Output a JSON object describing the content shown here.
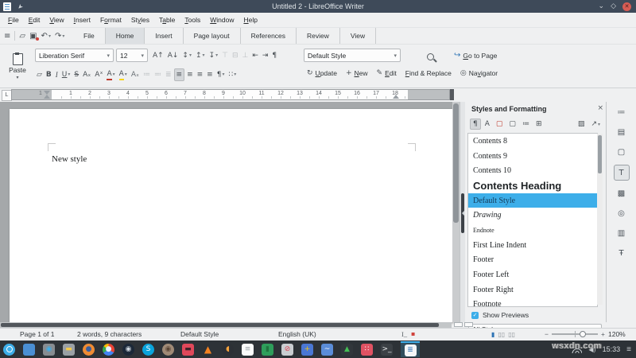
{
  "window": {
    "title": "Untitled 2 - LibreOffice Writer",
    "pin_icon": "➤",
    "minimize_icon": "⌄",
    "maximize_icon": "◇",
    "close_icon": "✕"
  },
  "colors": {
    "accent": "#3daee9",
    "titlebar": "#3e4a59",
    "taskbar": "#2d3237",
    "close_button": "#d75c54",
    "selection_text": "#153a57"
  },
  "menubar": {
    "items": [
      {
        "key": "F",
        "post": "ile"
      },
      {
        "key": "E",
        "post": "dit"
      },
      {
        "key": "V",
        "post": "iew"
      },
      {
        "key": "I",
        "post": "nsert"
      },
      {
        "pre": "F",
        "key": "o",
        "post": "rmat"
      },
      {
        "pre": "St",
        "key": "y",
        "post": "les"
      },
      {
        "pre": "T",
        "key": "a",
        "post": "ble"
      },
      {
        "key": "T",
        "post": "ools"
      },
      {
        "key": "W",
        "post": "indow"
      },
      {
        "key": "H",
        "post": "elp"
      }
    ]
  },
  "quickbar": {
    "icons": [
      {
        "name": "hamburger-menu-icon",
        "glyph": "≡"
      },
      {
        "name": "separator",
        "cls": "sep"
      },
      {
        "name": "open-icon",
        "glyph": "▱"
      },
      {
        "name": "save-icon",
        "glyph": "▣",
        "cls": "badge-red"
      },
      {
        "name": "undo-icon",
        "glyph": "↶",
        "caret": "▾"
      },
      {
        "name": "redo-icon",
        "glyph": "↷",
        "caret": "▾",
        "state": "disabled"
      }
    ],
    "tabs": [
      {
        "label": "File"
      },
      {
        "label": "Home",
        "state": "active"
      },
      {
        "label": "Insert"
      },
      {
        "label": "Page layout"
      },
      {
        "label": "References"
      },
      {
        "label": "Review"
      },
      {
        "label": "View"
      }
    ]
  },
  "toolbar": {
    "caret_glyph": "▾",
    "paste_label": "Paste",
    "font_name": "Liberation Serif",
    "font_size": "12",
    "paragraph_style": "Default Style",
    "goto_page": {
      "icon": "↪",
      "key": "G",
      "post": "o to Page"
    },
    "row1_icons": [
      {
        "name": "grow-font-icon",
        "glyph": "A↑"
      },
      {
        "name": "shrink-font-icon",
        "glyph": "A↓"
      },
      {
        "name": "line-spacing-icon",
        "glyph": "↕",
        "caret": "▾"
      },
      {
        "name": "increase-paragraph-spacing-icon",
        "glyph": "↥",
        "caret": "▾"
      },
      {
        "name": "decrease-paragraph-spacing-icon",
        "glyph": "↧",
        "caret": "▾"
      },
      {
        "name": "align-top-icon",
        "glyph": "⊤",
        "state": "disabled"
      },
      {
        "name": "center-vertically-icon",
        "glyph": "⊟",
        "state": "disabled"
      },
      {
        "name": "align-bottom-icon",
        "glyph": "⊥",
        "state": "disabled"
      },
      {
        "name": "decrease-indent-icon",
        "glyph": "⇤"
      },
      {
        "name": "increase-indent-icon",
        "glyph": "⇥"
      },
      {
        "name": "formatting-marks-icon",
        "glyph": "¶"
      }
    ],
    "row2_icons": [
      {
        "name": "clone-formatting-icon",
        "glyph": "▱"
      },
      {
        "name": "bold-icon",
        "glyph": "B",
        "cls": "b"
      },
      {
        "name": "italic-icon",
        "glyph": "I",
        "cls": "i"
      },
      {
        "name": "underline-icon",
        "glyph": "U",
        "cls": "u-l",
        "caret": "▾"
      },
      {
        "name": "strikethrough-icon",
        "glyph": "S",
        "cls": "s-t"
      },
      {
        "name": "subscript-icon",
        "glyph": "Aₓ"
      },
      {
        "name": "superscript-icon",
        "glyph": "Aˣ"
      },
      {
        "name": "font-color-icon",
        "glyph": "A",
        "cls": "fc",
        "caret": "▾"
      },
      {
        "name": "highlight-color-icon",
        "glyph": "A",
        "cls": "hc",
        "caret": "▾"
      },
      {
        "name": "clear-formatting-icon",
        "glyph": "Aₓ",
        "cls": "cf"
      },
      {
        "name": "bullet-list-icon",
        "glyph": "≔",
        "state": "disabled"
      },
      {
        "name": "numbered-list-icon",
        "glyph": "≕",
        "state": "disabled"
      },
      {
        "name": "outline-list-icon",
        "glyph": "≣",
        "state": "disabled"
      },
      {
        "name": "align-left-icon",
        "glyph": "≡",
        "state": "active"
      },
      {
        "name": "align-center-icon",
        "glyph": "≡"
      },
      {
        "name": "align-right-icon",
        "glyph": "≡"
      },
      {
        "name": "justify-icon",
        "glyph": "≡"
      },
      {
        "name": "paragraph-format-icon",
        "glyph": "¶",
        "caret": "▾"
      },
      {
        "name": "list-format-icon",
        "glyph": "∷",
        "caret": "▾"
      }
    ],
    "buttons": [
      {
        "name": "update-style-button",
        "icon": "↻",
        "key": "U",
        "post": "pdate"
      },
      {
        "name": "new-style-button",
        "icon": "+",
        "key": "N",
        "post": "ew"
      },
      {
        "name": "edit-style-button",
        "icon": "✎",
        "key": "E",
        "post": "dit"
      },
      {
        "name": "find-replace-button",
        "key": "F",
        "post": "ind & Replace"
      },
      {
        "name": "navigator-button",
        "icon": "◎",
        "pre": "Na",
        "key": "v",
        "post": "igator"
      }
    ]
  },
  "ruler": {
    "tab_selector": "L",
    "margin_number": "1",
    "numbers": [
      "1",
      "2",
      "3",
      "4",
      "5",
      "6",
      "7",
      "8",
      "9",
      "10",
      "11",
      "12",
      "13",
      "14",
      "15",
      "16",
      "17",
      "18"
    ]
  },
  "document": {
    "text": "New style"
  },
  "styles_panel": {
    "title": "Styles and Formatting",
    "close_icon": "×",
    "filter_icons": [
      {
        "name": "paragraph-styles-filter",
        "glyph": "¶",
        "state": "active"
      },
      {
        "name": "character-styles-filter",
        "glyph": "A"
      },
      {
        "name": "frame-styles-filter",
        "glyph": "▢",
        "cls": "red"
      },
      {
        "name": "page-styles-filter",
        "glyph": "▢"
      },
      {
        "name": "list-styles-filter",
        "glyph": "≔"
      },
      {
        "name": "table-styles-filter",
        "glyph": "⊞"
      }
    ],
    "action_icons": [
      {
        "name": "fill-format-mode-icon",
        "glyph": "▨"
      },
      {
        "name": "new-style-from-selection-icon",
        "glyph": "↗",
        "caret": "▾"
      }
    ],
    "items": [
      {
        "label": "Contents 8",
        "variant": "serif"
      },
      {
        "label": "Contents 9",
        "variant": "serif"
      },
      {
        "label": "Contents 10",
        "variant": "serif"
      },
      {
        "label": "Contents Heading",
        "variant": "heading"
      },
      {
        "label": "Default Style",
        "variant": "selected"
      },
      {
        "label": "Drawing",
        "variant": "italic"
      },
      {
        "label": "Endnote",
        "variant": "small"
      },
      {
        "label": "First Line Indent",
        "variant": "serif"
      },
      {
        "label": "Footer",
        "variant": "serif"
      },
      {
        "label": "Footer Left",
        "variant": "serif"
      },
      {
        "label": "Footer Right",
        "variant": "serif"
      },
      {
        "label": "Footnote",
        "variant": "serif"
      }
    ],
    "show_previews_label": "Show Previews",
    "checkbox_glyph": "✓",
    "filter_select_value": "All Styles",
    "select_caret": "⌄"
  },
  "sidebar_tabs": [
    {
      "name": "sidebar-tab-properties",
      "glyph": "≔"
    },
    {
      "name": "sidebar-tab-format",
      "glyph": "▤"
    },
    {
      "name": "sidebar-tab-page",
      "glyph": "▢"
    },
    {
      "name": "sidebar-tab-styles",
      "glyph": "T",
      "state": "active"
    },
    {
      "name": "sidebar-tab-gallery",
      "glyph": "▩"
    },
    {
      "name": "sidebar-tab-navigator",
      "glyph": "◎"
    },
    {
      "name": "sidebar-tab-document",
      "glyph": "▥"
    },
    {
      "name": "sidebar-tab-inspector",
      "glyph": "Ŧ"
    }
  ],
  "statusbar": {
    "page_count": "Page 1 of 1",
    "word_count": "2 words, 9 characters",
    "paragraph_style": "Default Style",
    "language": "English (UK)",
    "insert_icon": "I_",
    "modified_icon": "▪",
    "view_icons": [
      {
        "name": "single-page-view-icon",
        "glyph": "▮",
        "cls": "blue"
      },
      {
        "name": "multi-page-view-icon",
        "glyph": "▯▯"
      },
      {
        "name": "book-view-icon",
        "glyph": "▯▯"
      }
    ],
    "zoom_out": "−",
    "zoom_in": "+",
    "zoom_level": "120%"
  },
  "taskbar": {
    "icons": [
      {
        "name": "kde-launcher-icon",
        "cls": "circle kde",
        "bg": "#3daee9"
      },
      {
        "name": "virtual-desktop-icon",
        "cls": "square",
        "bg": "#4a8fd4"
      },
      {
        "name": "show-desktop-icon",
        "cls": "square",
        "bg": "#878c91",
        "glyph": "◉",
        "fg": "#3daee9"
      },
      {
        "name": "file-manager-icon",
        "cls": "square",
        "bg": "#9aa0a5",
        "glyph": "▬",
        "fg": "#f2c94c"
      },
      {
        "name": "firefox-icon",
        "cls": "circle",
        "bg": "#ef8b33",
        "glyph": "●",
        "fg": "#3a5f9f"
      },
      {
        "name": "chrome-icon",
        "cls": "circle chrome",
        "glyph": "●",
        "fg": "#e8f0fe"
      },
      {
        "name": "steam-icon",
        "cls": "circle",
        "bg": "#1b2838",
        "glyph": "◉",
        "fg": "#cfd8e0"
      },
      {
        "name": "skype-icon",
        "cls": "circle",
        "bg": "#0aa4dc",
        "glyph": "S",
        "fg": "#ffffff"
      },
      {
        "name": "gimp-icon",
        "cls": "circle",
        "bg": "#a08a76",
        "glyph": "◉",
        "fg": "#5b4636"
      },
      {
        "name": "media-player-icon",
        "cls": "square",
        "bg": "#e0485a",
        "glyph": "▬",
        "fg": "#40232a"
      },
      {
        "name": "vlc-icon",
        "cls": "plain",
        "glyph": "▲",
        "fg": "#f58220"
      },
      {
        "name": "crescent-app-icon",
        "cls": "circle",
        "bg": "#2c3036",
        "glyph": "◖",
        "fg": "#f5a33c"
      },
      {
        "name": "text-editor-icon",
        "cls": "square",
        "bg": "#fbfbfb",
        "glyph": "≡",
        "fg": "#98a0a6"
      },
      {
        "name": "dictionary-icon",
        "cls": "square",
        "bg": "#2e9e5b",
        "glyph": "▮",
        "fg": "#20743f"
      },
      {
        "name": "blocked-package-icon",
        "cls": "square",
        "bg": "#c9cdd1",
        "glyph": "⊘",
        "fg": "#da4453"
      },
      {
        "name": "remote-desktop-icon",
        "cls": "square",
        "bg": "#4a77d4",
        "glyph": "+",
        "fg": "#f1c40f"
      },
      {
        "name": "audio-app-icon",
        "cls": "square",
        "bg": "#5b8dd9",
        "glyph": "~",
        "fg": "#ffffff"
      },
      {
        "name": "photo-app-icon",
        "cls": "square",
        "bg": "#31363b",
        "glyph": "▲",
        "fg": "#45bf55"
      },
      {
        "name": "dots-app-icon",
        "cls": "square",
        "bg": "#e05263",
        "glyph": "∷",
        "fg": "#ffffff"
      },
      {
        "name": "terminal-icon",
        "cls": "square",
        "bg": "#3b4045",
        "glyph": ">_",
        "fg": "#e8eaec"
      },
      {
        "name": "writer-taskbar-icon",
        "cls": "square",
        "bg": "#f4f6f8",
        "glyph": "≣",
        "fg": "#2f74b5",
        "state": "active"
      }
    ],
    "volume_glyph": "◀)",
    "clock": "15:33",
    "menu_icon": "≡"
  },
  "watermark": "wsxdn.com"
}
